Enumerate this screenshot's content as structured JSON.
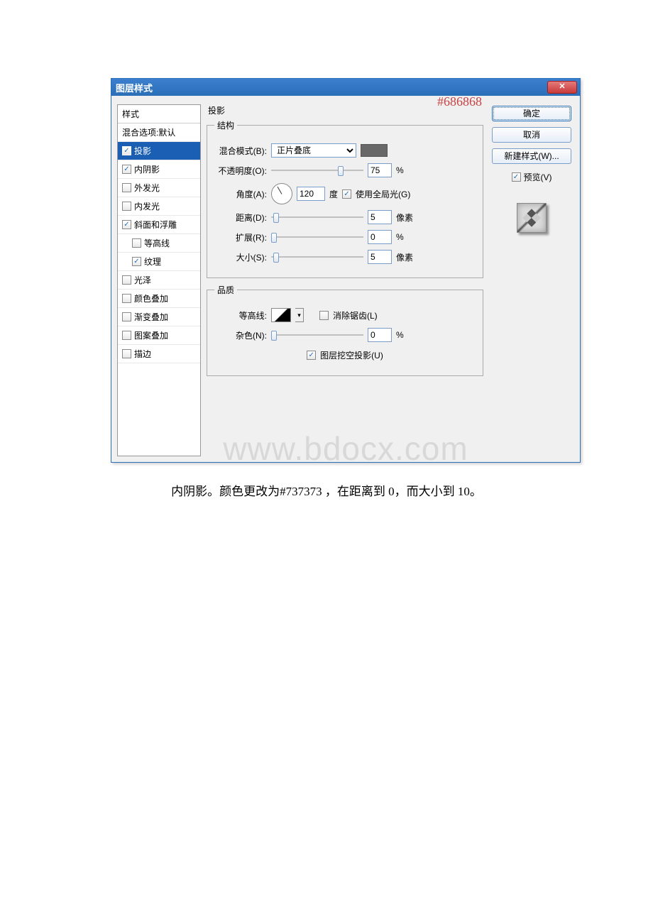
{
  "dialog": {
    "title": "图层样式",
    "hex_note": "#686868"
  },
  "styles": {
    "header": "样式",
    "items": [
      {
        "label": "混合选项:默认",
        "checked": null,
        "selected": false,
        "indent": false
      },
      {
        "label": "投影",
        "checked": true,
        "selected": true,
        "indent": false
      },
      {
        "label": "内阴影",
        "checked": true,
        "selected": false,
        "indent": false
      },
      {
        "label": "外发光",
        "checked": false,
        "selected": false,
        "indent": false
      },
      {
        "label": "内发光",
        "checked": false,
        "selected": false,
        "indent": false
      },
      {
        "label": "斜面和浮雕",
        "checked": true,
        "selected": false,
        "indent": false
      },
      {
        "label": "等高线",
        "checked": false,
        "selected": false,
        "indent": true
      },
      {
        "label": "纹理",
        "checked": true,
        "selected": false,
        "indent": true
      },
      {
        "label": "光泽",
        "checked": false,
        "selected": false,
        "indent": false
      },
      {
        "label": "颜色叠加",
        "checked": false,
        "selected": false,
        "indent": false
      },
      {
        "label": "渐变叠加",
        "checked": false,
        "selected": false,
        "indent": false
      },
      {
        "label": "图案叠加",
        "checked": false,
        "selected": false,
        "indent": false
      },
      {
        "label": "描边",
        "checked": false,
        "selected": false,
        "indent": false
      }
    ]
  },
  "section": {
    "title": "投影",
    "group_structure": "结构",
    "blend_label": "混合模式(B):",
    "blend_value": "正片叠底",
    "opacity_label": "不透明度(O):",
    "opacity_value": "75",
    "opacity_unit": "%",
    "angle_label": "角度(A):",
    "angle_value": "120",
    "angle_unit": "度",
    "global_light_label": "使用全局光(G)",
    "global_light_checked": true,
    "distance_label": "距离(D):",
    "distance_value": "5",
    "distance_unit": "像素",
    "spread_label": "扩展(R):",
    "spread_value": "0",
    "spread_unit": "%",
    "size_label": "大小(S):",
    "size_value": "5",
    "size_unit": "像素",
    "group_quality": "品质",
    "contour_label": "等高线:",
    "antialias_label": "消除锯齿(L)",
    "antialias_checked": false,
    "noise_label": "杂色(N):",
    "noise_value": "0",
    "noise_unit": "%",
    "knockout_label": "图层挖空投影(U)",
    "knockout_checked": true
  },
  "buttons": {
    "ok": "确定",
    "cancel": "取消",
    "new_style": "新建样式(W)...",
    "preview": "预览(V)",
    "preview_checked": true
  },
  "watermark": "www.bdocx.com",
  "caption": "内阴影。颜色更改为#737373 ，在距离到 0，而大小到 10。"
}
